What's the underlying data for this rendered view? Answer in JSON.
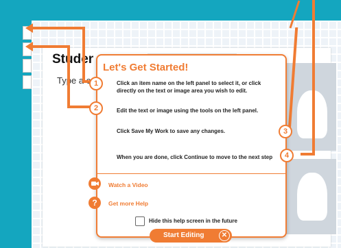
{
  "document": {
    "title": "Student Name",
    "subtitle": "Type a caption"
  },
  "dialog": {
    "title": "Let's Get Started!",
    "steps": [
      {
        "number": "1",
        "text": "Click an item name on the left panel to select it, or click directly on the text or image area you wish to edit."
      },
      {
        "number": "2",
        "text": "Edit the text or image using the tools on the left panel."
      },
      {
        "number": "3",
        "text": "Click Save My Work to save any changes."
      },
      {
        "number": "4",
        "text": "When you are done, click Continue to move to the next step"
      }
    ],
    "links": {
      "video": "Watch a Video",
      "help": "Get more Help"
    },
    "checkbox_label": "Hide this help screen in the future",
    "start_button": "Start Editing"
  },
  "colors": {
    "accent": "#f07c33",
    "frame": "#14a6bf"
  },
  "icons": {
    "video": "video-camera-icon",
    "help": "question-icon",
    "close": "close-circle-icon"
  }
}
